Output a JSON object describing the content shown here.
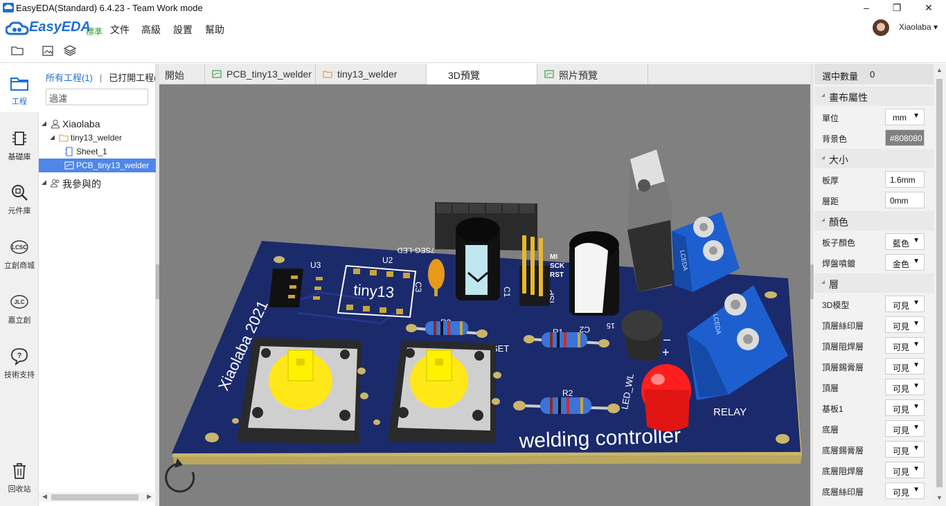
{
  "window": {
    "title": "EasyEDA(Standard) 6.4.23 - Team Work mode",
    "minimize": "–",
    "maximize": "❐",
    "close": "✕"
  },
  "brand": {
    "name": "EasyEDA",
    "edition": "標準"
  },
  "menu": [
    "文件",
    "高級",
    "設置",
    "幫助"
  ],
  "user": {
    "name": "Xiaolaba ▾"
  },
  "leftnav": [
    {
      "label": "工程",
      "icon": "folder-icon"
    },
    {
      "label": "基礎庫",
      "icon": "chip-icon"
    },
    {
      "label": "元件庫",
      "icon": "search-component-icon"
    },
    {
      "label": "立創商城",
      "icon": "lcsc-icon"
    },
    {
      "label": "嘉立創",
      "icon": "jlc-icon"
    },
    {
      "label": "技術支持",
      "icon": "help-icon"
    },
    {
      "label": "回收站",
      "icon": "trash-icon"
    }
  ],
  "project_panel": {
    "tab_all": "所有工程(1)",
    "separator": "|",
    "tab_open": "已打開工程(",
    "filter_value": "過濾",
    "tree": [
      {
        "label": "Xiaolaba",
        "caret": "◢"
      },
      {
        "label": "tiny13_welder",
        "caret": "◢"
      },
      {
        "label": "Sheet_1"
      },
      {
        "label": "PCB_tiny13_welder"
      },
      {
        "label": "我參與的",
        "caret": "◢"
      }
    ],
    "scroll_left": "◀",
    "scroll_right": "▶"
  },
  "tabs": [
    {
      "label": "開始"
    },
    {
      "label": "PCB_tiny13_welder"
    },
    {
      "label": "tiny13_welder"
    },
    {
      "label": "3D預覽"
    },
    {
      "label": "照片預覽"
    }
  ],
  "board": {
    "title": "welding controller",
    "author": "Xiaolaba 2021",
    "chip": "tiny13",
    "labels": [
      "U3",
      "U2",
      "C3",
      "C1",
      "C2",
      "R1",
      "R2",
      "R3",
      "ISP",
      "RELAY",
      "LED_WL",
      "7SEG-LED",
      "SET",
      "MI",
      "SCK",
      "RST",
      "15",
      "LCEDA",
      "LCEDA",
      "+",
      "–"
    ]
  },
  "props": {
    "selected_label": "選中數量",
    "selected_value": "0",
    "sections": {
      "canvas": "畫布屬性",
      "size": "大小",
      "color": "顏色",
      "layer": "層"
    },
    "canvas_rows": [
      {
        "label": "單位",
        "value": "mm"
      },
      {
        "label": "背景色",
        "value": "#808080"
      }
    ],
    "size_rows": [
      {
        "label": "板厚",
        "value": "1.6mm"
      },
      {
        "label": "層距",
        "value": "0mm"
      }
    ],
    "color_rows": [
      {
        "label": "板子顏色",
        "value": "藍色"
      },
      {
        "label": "焊盤噴鍍",
        "value": "金色"
      }
    ],
    "layer_rows": [
      {
        "label": "3D模型",
        "value": "可見"
      },
      {
        "label": "頂層絲印層",
        "value": "可見"
      },
      {
        "label": "頂層阻焊層",
        "value": "可見"
      },
      {
        "label": "頂層錫膏層",
        "value": "可見"
      },
      {
        "label": "頂層",
        "value": "可見"
      },
      {
        "label": "基板1",
        "value": "可見"
      },
      {
        "label": "底層",
        "value": "可見"
      },
      {
        "label": "底層錫膏層",
        "value": "可見"
      },
      {
        "label": "底層阻焊層",
        "value": "可見"
      },
      {
        "label": "底層絲印層",
        "value": "可見"
      }
    ],
    "dropdown_glyph": "▼"
  },
  "colors": {
    "accent": "#1d6fd3",
    "viewport_bg": "#808080",
    "board_blue": "#1b2a6b",
    "selection": "#4f86e8"
  }
}
